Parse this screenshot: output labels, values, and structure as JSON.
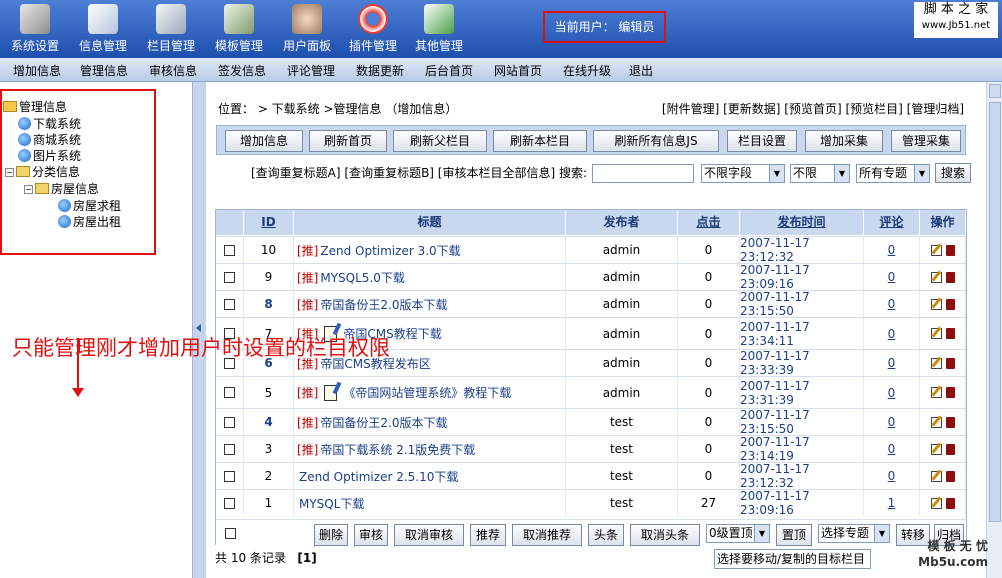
{
  "toolbar": [
    {
      "label": "系统设置",
      "icon": "wrench-icon"
    },
    {
      "label": "信息管理",
      "icon": "documents-icon"
    },
    {
      "label": "栏目管理",
      "icon": "columns-icon"
    },
    {
      "label": "模板管理",
      "icon": "template-icon"
    },
    {
      "label": "用户面板",
      "icon": "users-icon"
    },
    {
      "label": "插件管理",
      "icon": "lifebuoy-icon"
    },
    {
      "label": "其他管理",
      "icon": "other-icon"
    }
  ],
  "current_user": "当前用户： 编辑员",
  "site_logo": {
    "cn": "脚 本 之 家",
    "url": "www.Jb51.net"
  },
  "menu": [
    "增加信息",
    "管理信息",
    "审核信息",
    "签发信息",
    "评论管理",
    "数据更新",
    "后台首页",
    "网站首页",
    "在线升级",
    "退出"
  ],
  "tree": {
    "root": "管理信息",
    "items": [
      "下载系统",
      "商城系统",
      "图片系统"
    ],
    "group": "分类信息",
    "subgroup": "房屋信息",
    "leaves": [
      "房屋求租",
      "房屋出租"
    ]
  },
  "annotation": "只能管理刚才增加用户时设置的栏目权限",
  "breadcrumb": "位置：  > 下载系统 >管理信息 （增加信息）",
  "top_links": "[附件管理] [更新数据] [预览首页] [预览栏目] [管理归档]",
  "buttons": [
    "增加信息",
    "刷新首页",
    "刷新父栏目",
    "刷新本栏目",
    "刷新所有信息JS",
    "栏目设置",
    "增加采集",
    "管理采集"
  ],
  "query": {
    "links": "[查询重复标题A] [查询重复标题B] [审核本栏目全部信息] 搜索:",
    "field": "不限字段",
    "limit": "不限",
    "topic": "所有专题",
    "search": "搜索"
  },
  "table": {
    "headers": [
      "ID",
      "标题",
      "发布者",
      "点击",
      "发布时间",
      "评论",
      "操作"
    ],
    "rows": [
      {
        "id": "10",
        "tag": "[推]",
        "doc": false,
        "title": "Zend Optimizer 3.0下载",
        "user": "admin",
        "clicks": "0",
        "time": "2007-11-17 23:12:32",
        "comments": "0",
        "bold": false
      },
      {
        "id": "9",
        "tag": "[推]",
        "doc": false,
        "title": "MYSQL5.0下载",
        "user": "admin",
        "clicks": "0",
        "time": "2007-11-17 23:09:16",
        "comments": "0",
        "bold": false
      },
      {
        "id": "8",
        "tag": "[推]",
        "doc": false,
        "title": "帝国备份王2.0版本下载",
        "user": "admin",
        "clicks": "0",
        "time": "2007-11-17 23:15:50",
        "comments": "0",
        "bold": true
      },
      {
        "id": "7",
        "tag": "[推]",
        "doc": true,
        "title": "帝国CMS教程下载",
        "user": "admin",
        "clicks": "0",
        "time": "2007-11-17 23:34:11",
        "comments": "0",
        "bold": false
      },
      {
        "id": "6",
        "tag": "[推]",
        "doc": false,
        "title": "帝国CMS教程发布区",
        "user": "admin",
        "clicks": "0",
        "time": "2007-11-17 23:33:39",
        "comments": "0",
        "bold": true
      },
      {
        "id": "5",
        "tag": "[推]",
        "doc": true,
        "title": "《帝国网站管理系统》教程下载",
        "user": "admin",
        "clicks": "0",
        "time": "2007-11-17 23:31:39",
        "comments": "0",
        "bold": false
      },
      {
        "id": "4",
        "tag": "[推]",
        "doc": false,
        "title": "帝国备份王2.0版本下载",
        "user": "test",
        "clicks": "0",
        "time": "2007-11-17 23:15:50",
        "comments": "0",
        "bold": true
      },
      {
        "id": "3",
        "tag": "[推]",
        "doc": false,
        "title": "帝国下载系统 2.1版免费下载",
        "user": "test",
        "clicks": "0",
        "time": "2007-11-17 23:14:19",
        "comments": "0",
        "bold": false
      },
      {
        "id": "2",
        "tag": "",
        "doc": false,
        "title": "Zend Optimizer 2.5.10下载",
        "user": "test",
        "clicks": "0",
        "time": "2007-11-17 23:12:32",
        "comments": "0",
        "bold": false
      },
      {
        "id": "1",
        "tag": "",
        "doc": false,
        "title": "MYSQL下载",
        "user": "test",
        "clicks": "27",
        "time": "2007-11-17 23:09:16",
        "comments": "1",
        "bold": false
      }
    ]
  },
  "actions": {
    "buttons": [
      "删除",
      "审核",
      "取消审核",
      "推荐",
      "取消推荐",
      "头条",
      "取消头条"
    ],
    "level": "0级置顶",
    "top": "置顶",
    "topic": "选择专题",
    "move": "转移",
    "archive": "归档"
  },
  "footer": {
    "count": "共 10 条记录",
    "page": "[1]",
    "move_select": "选择要移动/复制的目标栏目"
  },
  "watermark": {
    "line1": "模 板 无 忧",
    "line2": "Mb5u.com"
  }
}
